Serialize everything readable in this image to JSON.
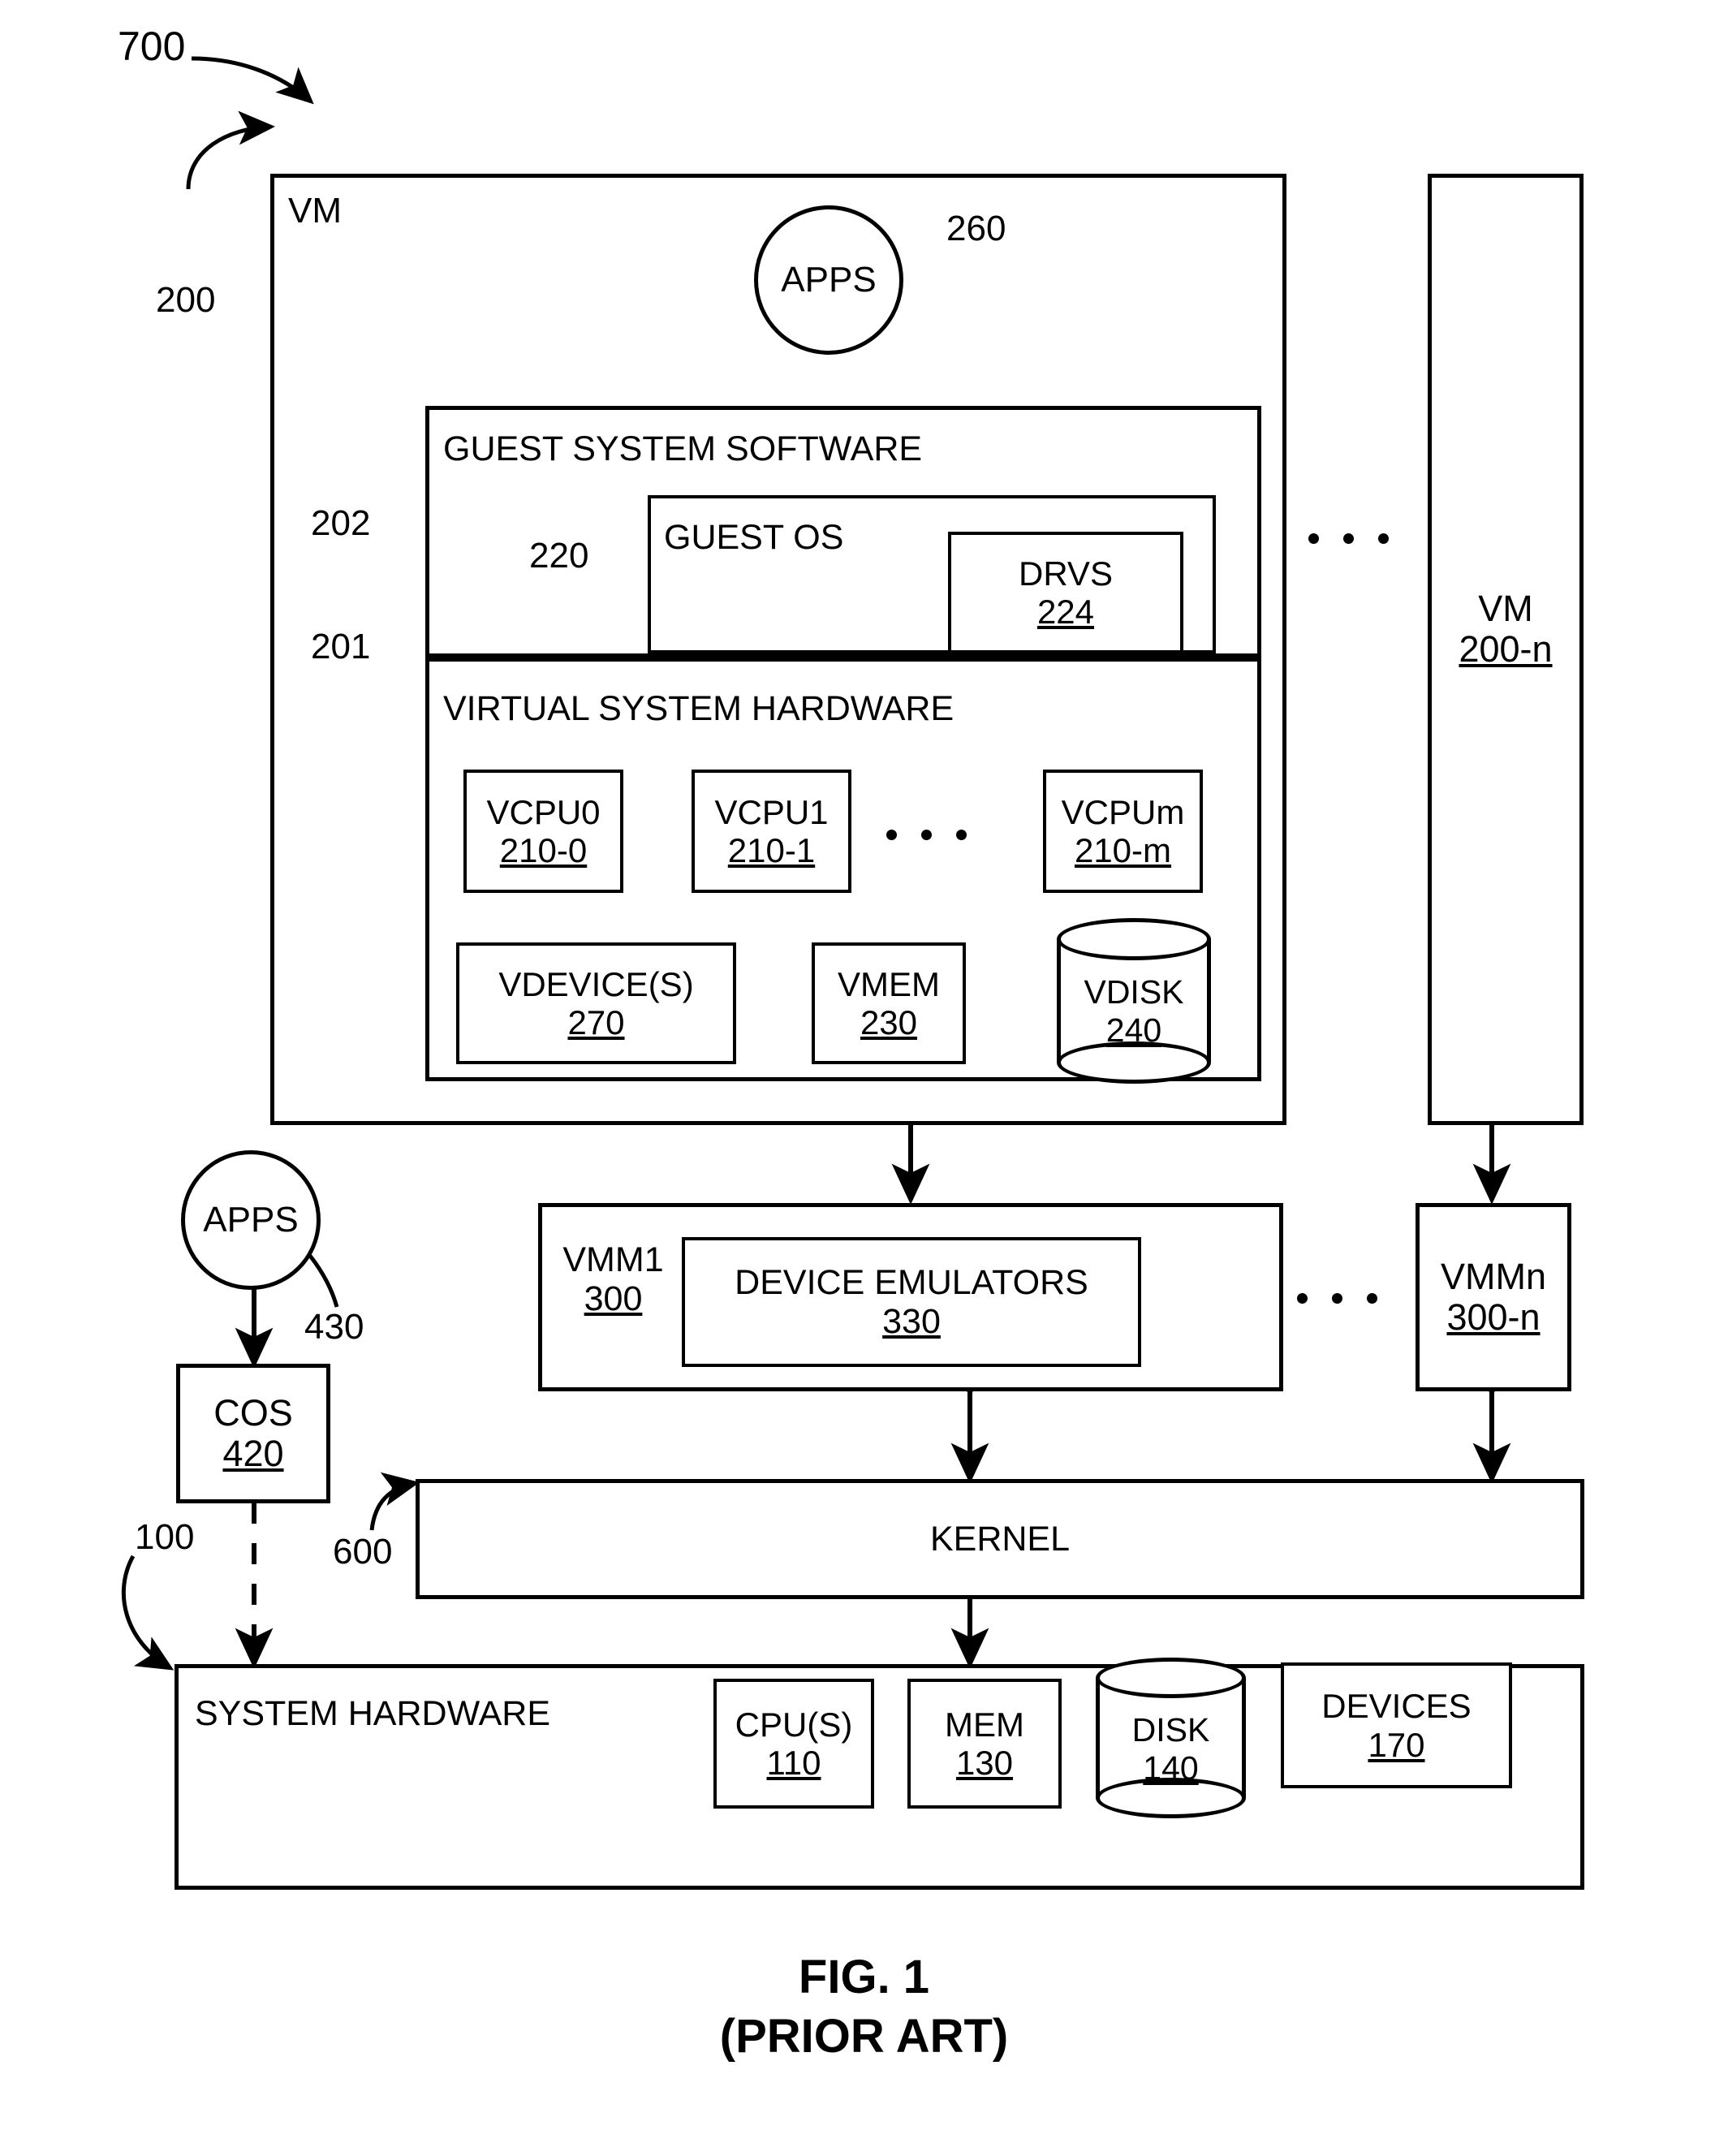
{
  "figure": {
    "number_label": "700",
    "caption_line1": "FIG. 1",
    "caption_line2": "(PRIOR ART)"
  },
  "vm": {
    "title": "VM",
    "ref": "200",
    "apps": {
      "label": "APPS",
      "ref": "260"
    },
    "guest_system_software": {
      "title": "GUEST SYSTEM SOFTWARE",
      "ref": "202",
      "guest_os": {
        "title": "GUEST OS",
        "ref": "220",
        "drvs": {
          "label": "DRVS",
          "ref": "224"
        }
      }
    },
    "virtual_system_hardware": {
      "title": "VIRTUAL SYSTEM HARDWARE",
      "ref": "201",
      "vcpus": [
        {
          "label": "VCPU0",
          "ref": "210-0"
        },
        {
          "label": "VCPU1",
          "ref": "210-1"
        },
        {
          "label": "VCPUm",
          "ref": "210-m"
        }
      ],
      "vcpu_ellipsis": "...",
      "vdevices": {
        "label": "VDEVICE(S)",
        "ref": "270"
      },
      "vmem": {
        "label": "VMEM",
        "ref": "230"
      },
      "vdisk": {
        "label": "VDISK",
        "ref": "240"
      }
    }
  },
  "vm_n": {
    "label": "VM",
    "ref": "200-n",
    "ellipsis": "..."
  },
  "vmm1": {
    "label": "VMM1",
    "ref": "300",
    "device_emulators": {
      "label": "DEVICE EMULATORS",
      "ref": "330"
    }
  },
  "vmm_n": {
    "label": "VMMn",
    "ref": "300-n",
    "ellipsis": "..."
  },
  "console": {
    "apps": {
      "label": "APPS",
      "ref": "430"
    },
    "cos": {
      "label": "COS",
      "ref": "420"
    }
  },
  "kernel": {
    "label": "KERNEL",
    "ref": "600"
  },
  "system_hardware": {
    "title": "SYSTEM HARDWARE",
    "ref": "100",
    "components": [
      {
        "label": "CPU(S)",
        "ref": "110",
        "shape": "box"
      },
      {
        "label": "MEM",
        "ref": "130",
        "shape": "box"
      },
      {
        "label": "DISK",
        "ref": "140",
        "shape": "cylinder"
      },
      {
        "label": "DEVICES",
        "ref": "170",
        "shape": "box"
      }
    ]
  },
  "colors": {
    "stroke": "#000000",
    "background": "#ffffff"
  }
}
